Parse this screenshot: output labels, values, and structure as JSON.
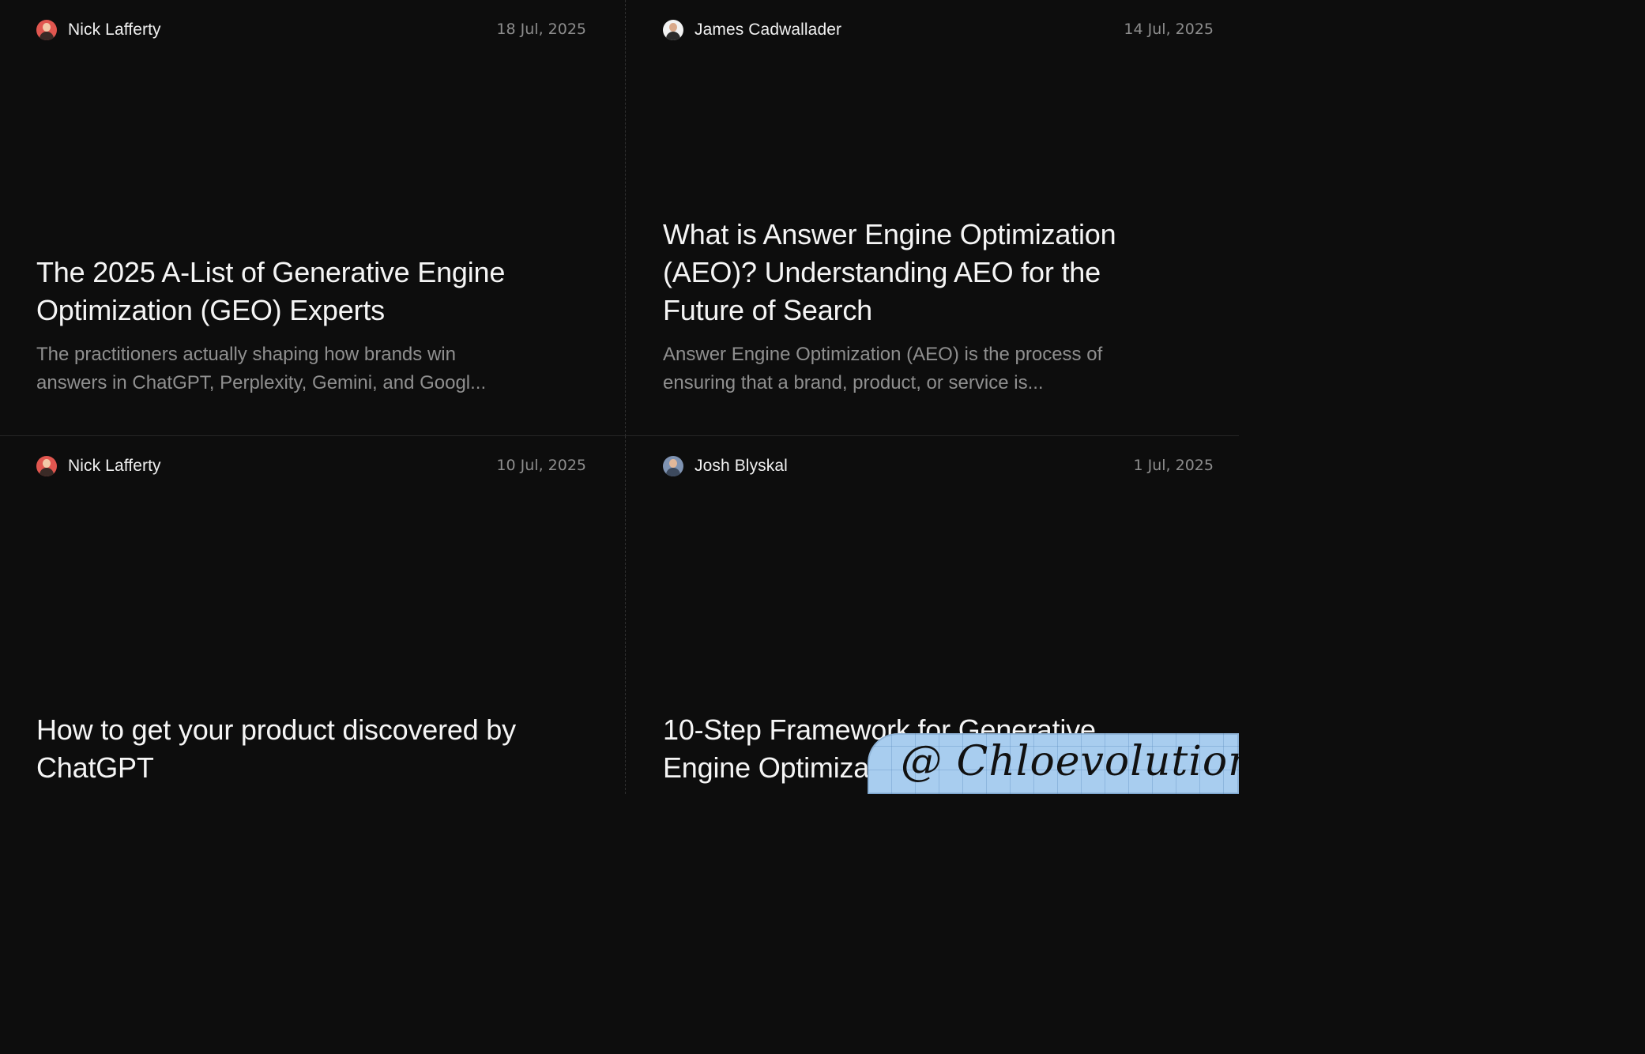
{
  "posts": [
    {
      "author": "Nick Lafferty",
      "date": "18 Jul, 2025",
      "title": "The 2025 A-List of Generative Engine Optimization (GEO) Experts",
      "excerpt": "The practitioners actually shaping how brands win answers in ChatGPT, Perplexity, Gemini, and Googl...",
      "avatar_colors": {
        "bg": "#e0564f",
        "head": "#f2c9a8",
        "body": "#3a2a26"
      }
    },
    {
      "author": "James Cadwallader",
      "date": "14 Jul, 2025",
      "title": "What is Answer Engine Optimization (AEO)? Understanding AEO for the Future of Search",
      "excerpt": "Answer Engine Optimization (AEO) is the process of ensuring that a brand, product, or service is...",
      "avatar_colors": {
        "bg": "#f2f2f2",
        "head": "#d9a98a",
        "body": "#2b2b2b"
      }
    },
    {
      "author": "Nick Lafferty",
      "date": "10 Jul, 2025",
      "title": "How to get your product discovered by ChatGPT",
      "excerpt": "",
      "avatar_colors": {
        "bg": "#e0564f",
        "head": "#f2c9a8",
        "body": "#3a2a26"
      }
    },
    {
      "author": "Josh Blyskal",
      "date": "1 Jul, 2025",
      "title": "10-Step Framework for Generative Engine Optimization",
      "excerpt": "",
      "avatar_colors": {
        "bg": "#7f93b2",
        "head": "#e3b899",
        "body": "#3d4a5e"
      }
    }
  ],
  "watermark": {
    "text": "@ Chloevolution"
  },
  "colors": {
    "background": "#0d0d0d",
    "title": "#f5f5f5",
    "excerpt": "#8f8f8f",
    "date": "#8d8d8d",
    "watermark_bg": "#a8cdef"
  }
}
